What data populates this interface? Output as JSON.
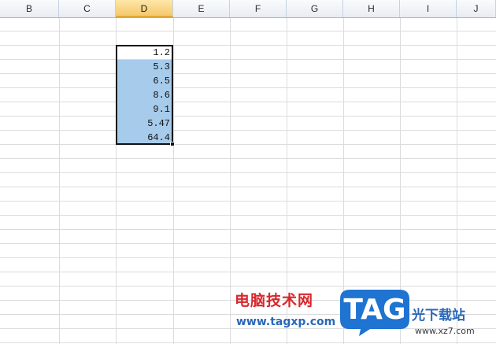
{
  "columns": [
    "B",
    "C",
    "D",
    "E",
    "F",
    "G",
    "H",
    "I",
    "J"
  ],
  "active_column": "D",
  "cells": [
    "1.2",
    "5.3",
    "6.5",
    "8.6",
    "9.1",
    "5.47",
    "64.4"
  ],
  "colors": {
    "selection": "#a7cbeb",
    "grid": "#dadcdd",
    "active_header": "#f6c86b"
  },
  "watermark": {
    "cn": "电脑技术网",
    "url": "www.tagxp.com",
    "logo": "TAG",
    "site": "光下载站",
    "site2": "www.xz7.com"
  }
}
